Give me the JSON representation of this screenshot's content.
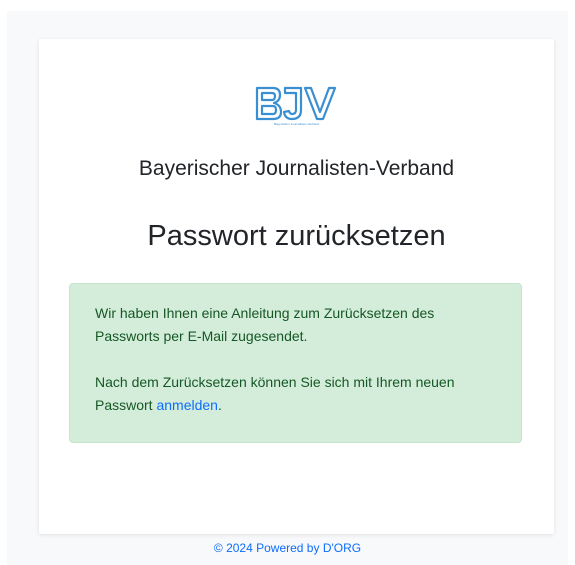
{
  "brand": {
    "logo_letters": "BJV",
    "logo_caption": "Bayerischer Journalisten-Verband",
    "org_name": "Bayerischer Journalisten-Verband",
    "color": "#3a8fd2"
  },
  "page": {
    "title": "Passwort zurücksetzen"
  },
  "alert": {
    "line1": "Wir haben Ihnen eine Anleitung zum Zurücksetzen des Passworts per E-Mail zugesendet.",
    "line2_prefix": "Nach dem Zurücksetzen können Sie sich mit Ihrem neuen Passwort ",
    "line2_link": "anmelden",
    "line2_suffix": "."
  },
  "footer": {
    "copyright": "© 2024 Powered by ",
    "link": "D'ORG"
  }
}
